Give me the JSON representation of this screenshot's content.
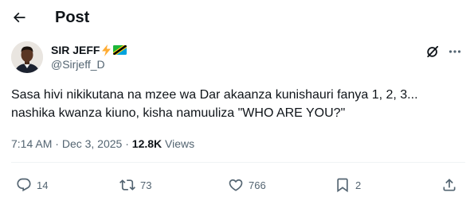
{
  "header": {
    "title": "Post"
  },
  "author": {
    "name": "SIR JEFF",
    "handle": "@Sirjeff_D",
    "badges": [
      "lightning-bolt-emoji",
      "tanzania-flag-emoji"
    ]
  },
  "tweet": {
    "lines": [
      "Sasa hivi nikikutana na mzee wa Dar akaanza kunishauri fanya 1, 2, 3...",
      "nashika kwanza kiuno, kisha namuuliza \"WHO ARE YOU?\""
    ]
  },
  "meta": {
    "time": "7:14 AM",
    "separator": "·",
    "date": "Dec 3, 2025",
    "views_count": "12.8K",
    "views_label": "Views"
  },
  "actions": {
    "replies": "14",
    "reposts": "73",
    "likes": "766",
    "bookmarks": "2"
  },
  "colors": {
    "text": "#0f1419",
    "secondary": "#536471",
    "divider": "#eff3f4",
    "background": "#ffffff"
  }
}
